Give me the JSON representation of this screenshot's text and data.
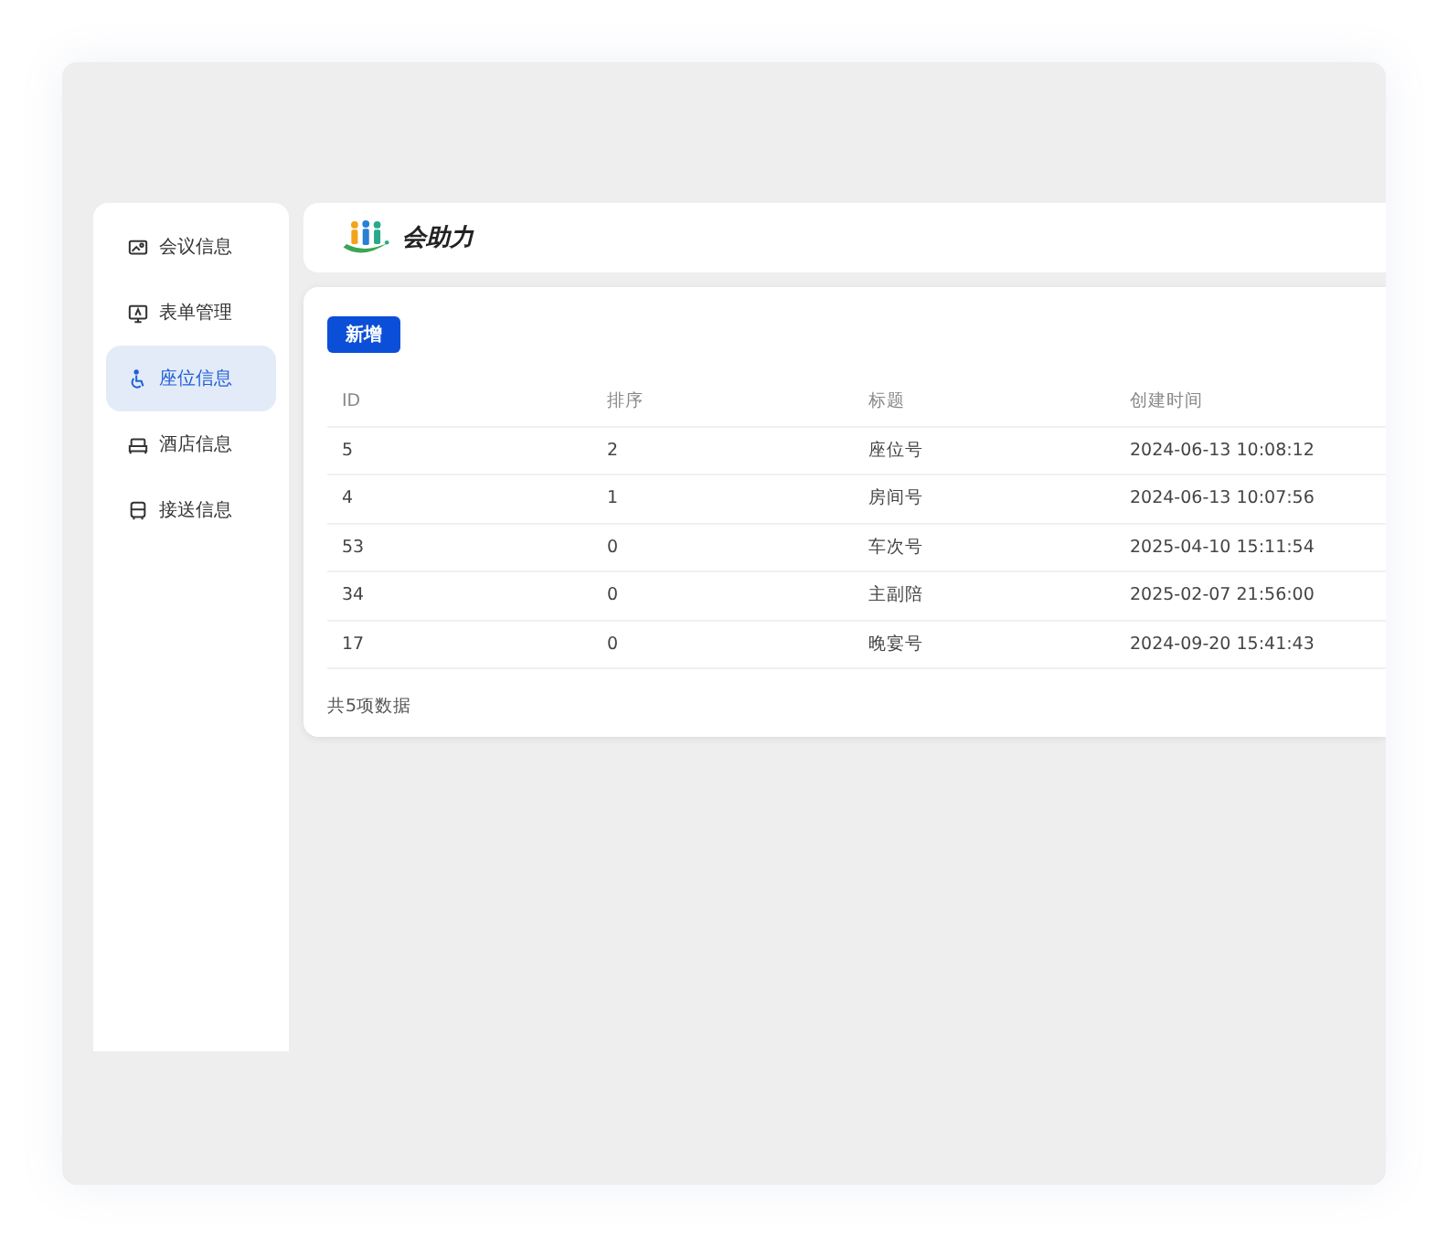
{
  "sidebar": {
    "items": [
      {
        "label": "会议信息",
        "selected": false
      },
      {
        "label": "表单管理",
        "selected": false
      },
      {
        "label": "座位信息",
        "selected": true
      },
      {
        "label": "酒店信息",
        "selected": false
      },
      {
        "label": "接送信息",
        "selected": false
      }
    ]
  },
  "header": {
    "logo_text": "会助力"
  },
  "toolbar": {
    "add_button": "新增"
  },
  "table": {
    "columns": [
      "ID",
      "排序",
      "标题",
      "创建时间"
    ],
    "rows": [
      [
        "5",
        "2",
        "座位号",
        "2024-06-13 10:08:12"
      ],
      [
        "4",
        "1",
        "房间号",
        "2024-06-13 10:07:56"
      ],
      [
        "53",
        "0",
        "车次号",
        "2025-04-10 15:11:54"
      ],
      [
        "34",
        "0",
        "主副陪",
        "2025-02-07 21:56:00"
      ],
      [
        "17",
        "0",
        "晚宴号",
        "2024-09-20 15:41:43"
      ]
    ]
  },
  "footer": {
    "total": "共5项数据"
  }
}
